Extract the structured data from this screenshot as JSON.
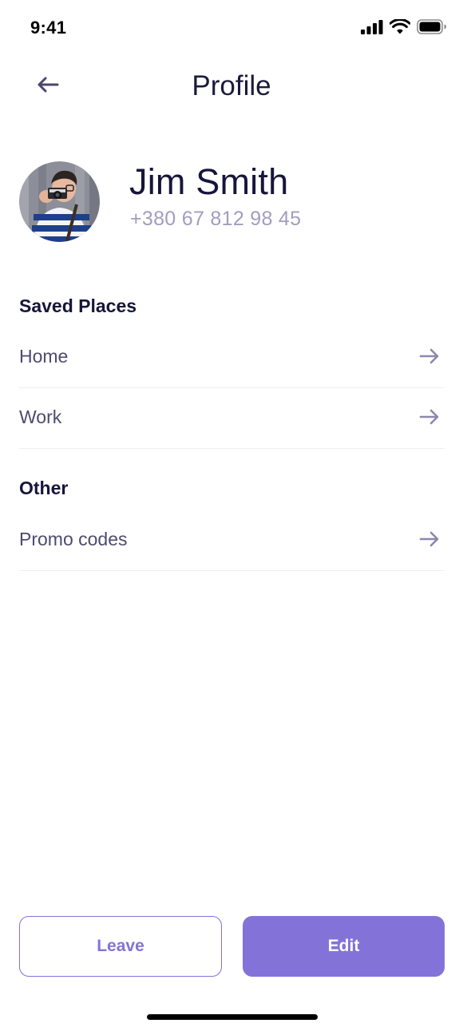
{
  "status_bar": {
    "time": "9:41",
    "icons": [
      "cellular-signal-icon",
      "wifi-icon",
      "battery-icon"
    ]
  },
  "header": {
    "title": "Profile",
    "back_icon": "arrow-left-icon"
  },
  "profile": {
    "name": "Jim Smith",
    "phone": "+380 67 812 98 45",
    "avatar_icon": "user-avatar-photo"
  },
  "sections": [
    {
      "title": "Saved Places",
      "items": [
        {
          "label": "Home",
          "icon": "arrow-right-icon"
        },
        {
          "label": "Work",
          "icon": "arrow-right-icon"
        }
      ]
    },
    {
      "title": "Other",
      "items": [
        {
          "label": "Promo codes",
          "icon": "arrow-right-icon"
        }
      ]
    }
  ],
  "actions": {
    "leave_label": "Leave",
    "edit_label": "Edit"
  },
  "colors": {
    "accent": "#8373d9",
    "title_text": "#1c1a3b",
    "secondary_text": "#a19dbe",
    "item_text": "#4e4a6e",
    "arrow": "#8d87ad",
    "divider": "#efeff4"
  }
}
